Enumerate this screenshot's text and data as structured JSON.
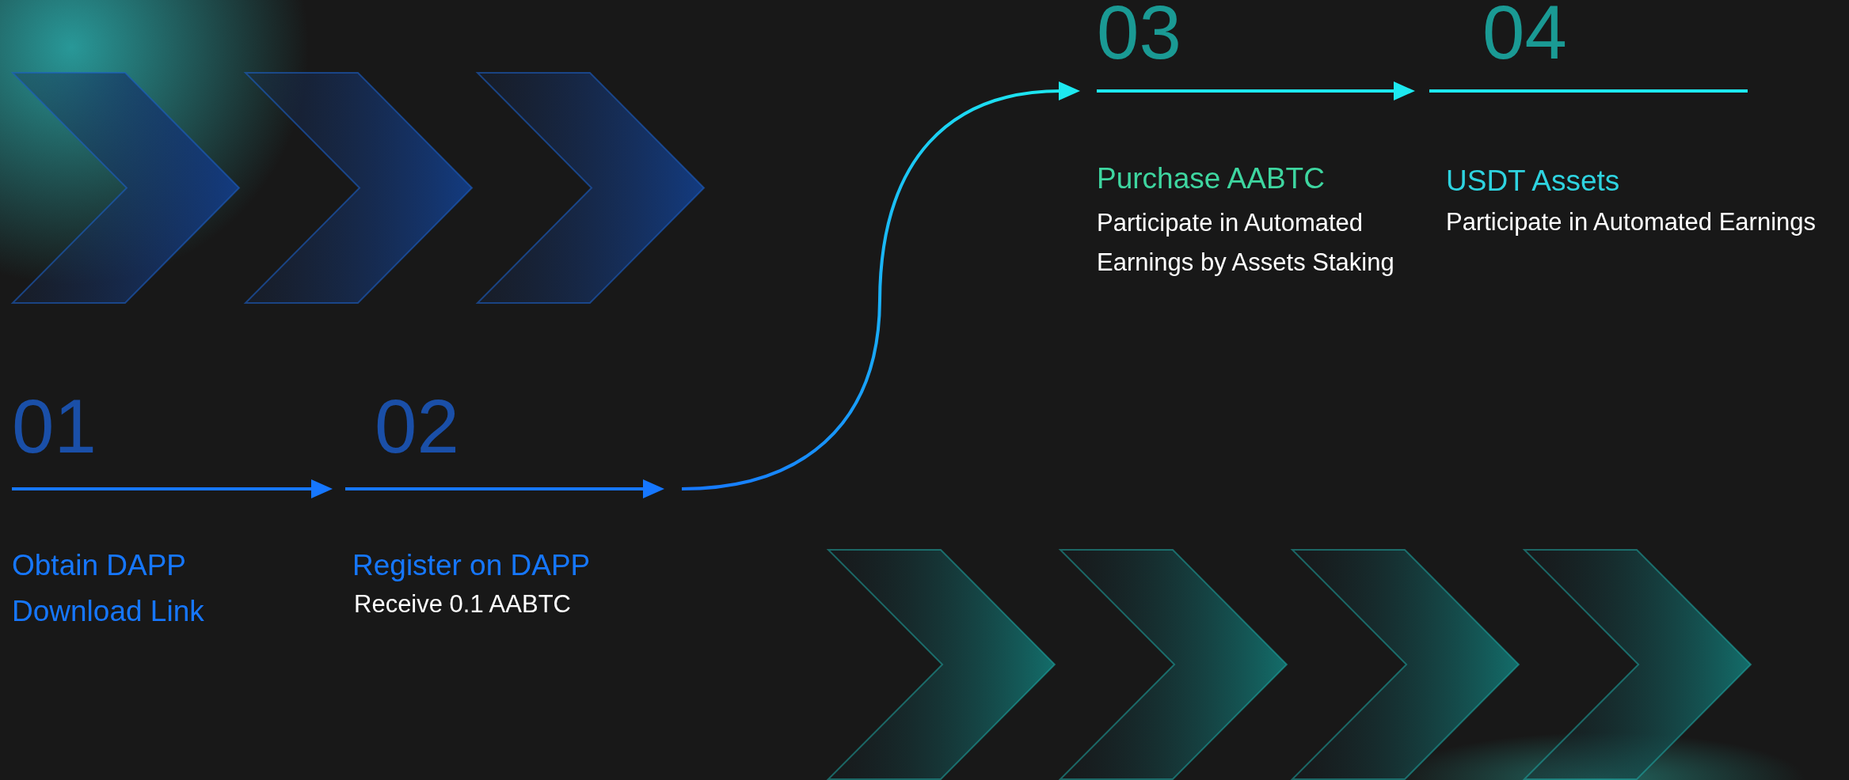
{
  "lower_steps": [
    {
      "number": "01",
      "title_lines": [
        "Obtain DAPP",
        "Download Link"
      ]
    },
    {
      "number": "02",
      "title_lines": [
        "Register on DAPP"
      ],
      "description_lines": [
        "Receive 0.1 AABTC"
      ]
    }
  ],
  "upper_steps": [
    {
      "number": "03",
      "title_lines": [
        "Purchase AABTC"
      ],
      "description_lines": [
        "Participate in Automated",
        "Earnings by Assets Staking"
      ]
    },
    {
      "number": "04",
      "title_lines": [
        "USDT Assets"
      ],
      "description_lines": [
        "Participate in Automated Earnings"
      ]
    }
  ]
}
